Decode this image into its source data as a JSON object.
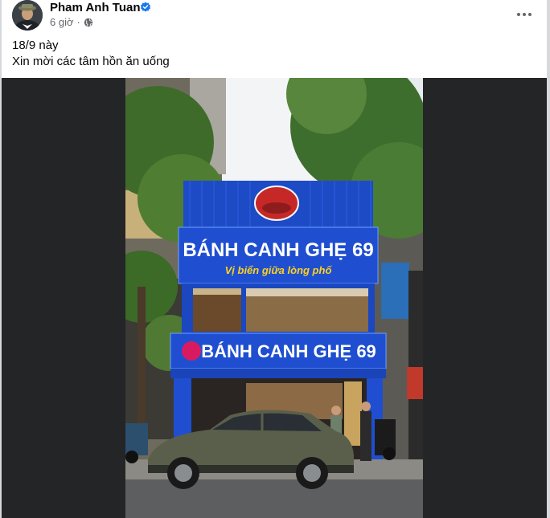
{
  "post": {
    "author_name": "Pham Anh Tuan",
    "time_label": "6 giờ",
    "more_label": "•••",
    "caption_lines": [
      "18/9 này",
      "Xin mời các tâm hồn ăn uống"
    ]
  },
  "photo": {
    "sign_main_top": "BÁNH CANH GHẸ 69",
    "sign_slogan": "Vị biển giữa lòng phố",
    "sign_main_bottom": "BÁNH CANH GHẸ 69"
  },
  "colors": {
    "brand_blue": "#1877f2",
    "sign_blue": "#1f4fd0",
    "slogan_yellow": "#ffd21f",
    "car_green": "#5a5f4b",
    "media_bg": "#242526"
  },
  "icons": [
    "avatar",
    "verified-badge-icon",
    "globe-icon",
    "more-options-icon"
  ]
}
